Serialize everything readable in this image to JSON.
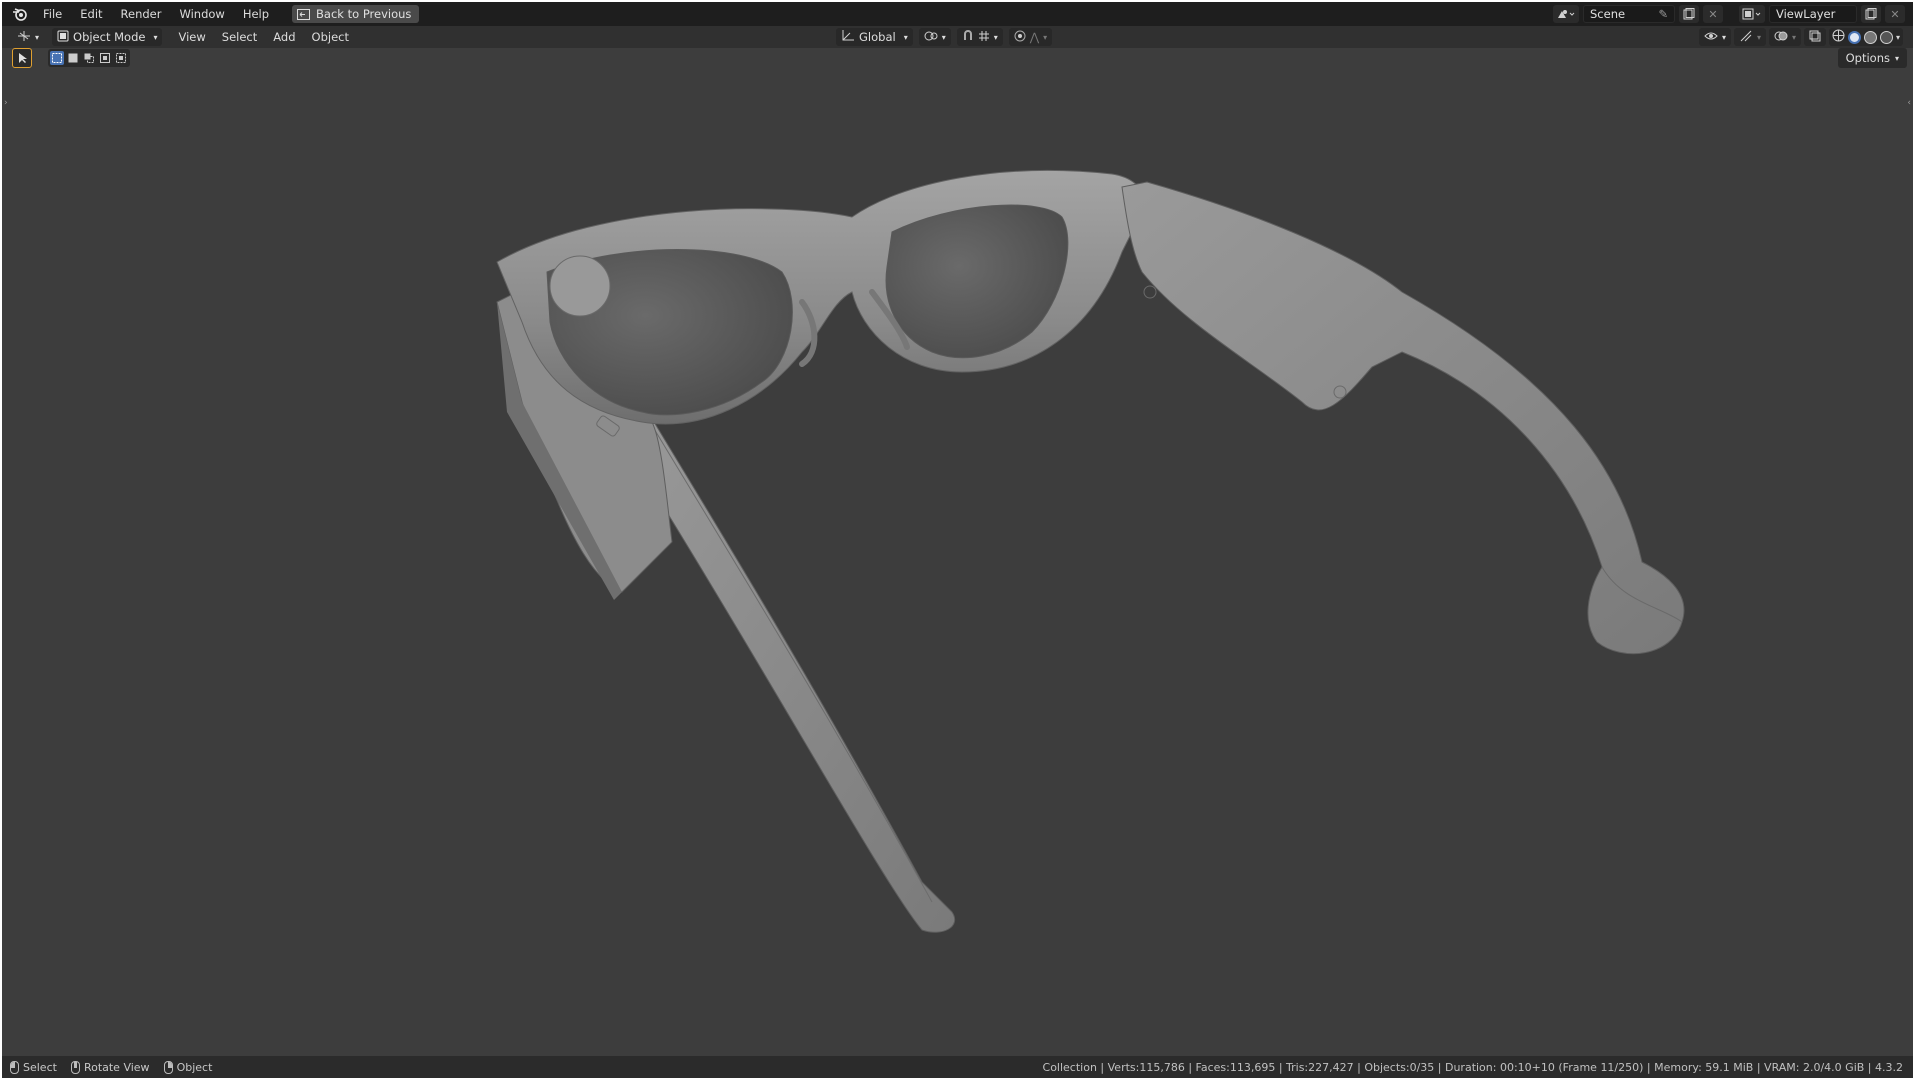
{
  "menubar": {
    "items": [
      "File",
      "Edit",
      "Render",
      "Window",
      "Help"
    ],
    "back_button": "Back to Previous",
    "scene": "Scene",
    "view_layer": "ViewLayer"
  },
  "header": {
    "mode": "Object Mode",
    "menus": [
      "View",
      "Select",
      "Add",
      "Object"
    ],
    "orientation": "Global",
    "options": "Options"
  },
  "statusbar": {
    "hints": [
      "Select",
      "Rotate View",
      "Object"
    ],
    "stats": "Collection | Verts:115,786 | Faces:113,695 | Tris:227,427 | Objects:0/35 | Duration: 00:10+10 (Frame 11/250) | Memory: 59.1 MiB | VRAM: 2.0/4.0 GiB | 4.3.2"
  },
  "colors": {
    "viewport_bg": "#3d3d3d",
    "model_fill": "#8c8c8c",
    "accent": "#4772b3"
  },
  "icons": [
    "blender-logo-icon",
    "back-icon",
    "editor-type-icon",
    "object-mode-icon",
    "orientation-icon",
    "pivot-icon",
    "snap-icon",
    "proportional-icon",
    "visibility-icon",
    "gizmo-icon",
    "overlay-icon",
    "xray-icon",
    "wireframe-shading-icon",
    "solid-shading-icon",
    "material-shading-icon",
    "rendered-shading-icon"
  ]
}
